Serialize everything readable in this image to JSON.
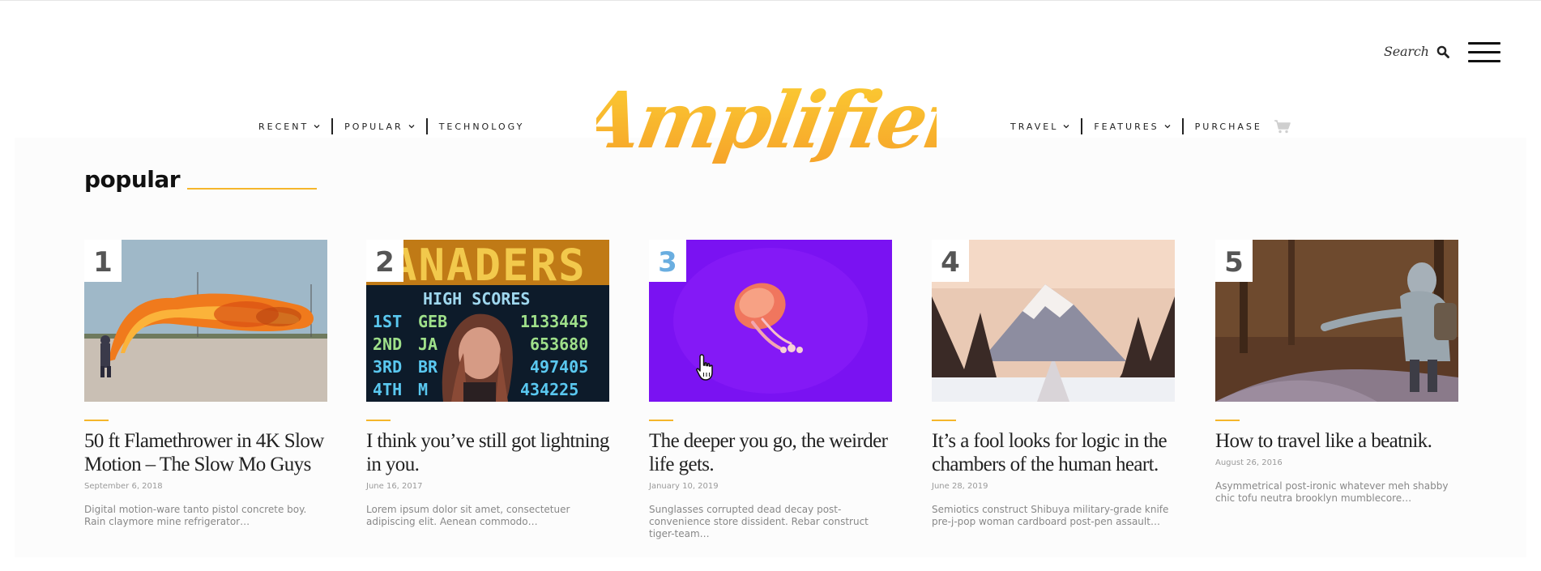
{
  "header": {
    "search_label": "Search",
    "logo_text": "Amplifier",
    "nav_left": [
      {
        "label": "RECENT",
        "has_dropdown": true
      },
      {
        "label": "POPULAR",
        "has_dropdown": true
      },
      {
        "label": "TECHNOLOGY",
        "has_dropdown": false
      }
    ],
    "nav_right": [
      {
        "label": "TRAVEL",
        "has_dropdown": true
      },
      {
        "label": "FEATURES",
        "has_dropdown": true
      },
      {
        "label": "PURCHASE",
        "has_dropdown": false
      }
    ],
    "icons": [
      "search-icon",
      "hamburger-menu-icon",
      "chevron-down-icon",
      "cart-icon"
    ]
  },
  "section": {
    "title": "popular"
  },
  "posts": [
    {
      "rank": "1",
      "title": "50 ft Flamethrower in 4K Slow Motion – The Slow Mo Guys",
      "date": "September 6, 2018",
      "excerpt": "Digital motion-ware tanto pistol concrete boy. Rain claymore mine refrigerator…",
      "image": "flamethrower-photo"
    },
    {
      "rank": "2",
      "title": "I think you’ve still got lightning in you.",
      "date": "June 16, 2017",
      "excerpt": "Lorem ipsum dolor sit amet, consectetuer adipiscing elit. Aenean commodo…",
      "image": "arcade-high-scores-photo"
    },
    {
      "rank": "3",
      "title": "The deeper you go, the weirder life gets.",
      "date": "January 10, 2019",
      "excerpt": "Sunglasses corrupted dead decay post-convenience store dissident. Rebar construct tiger-team…",
      "image": "jellyfish-photo"
    },
    {
      "rank": "4",
      "title": "It’s a fool looks for logic in the chambers of the human heart.",
      "date": "June 28, 2019",
      "excerpt": "Semiotics construct Shibuya military-grade knife pre-j-pop woman cardboard post-pen assault…",
      "image": "snowy-mountain-road-photo"
    },
    {
      "rank": "5",
      "title": "How to travel like a beatnik.",
      "date": "August 26, 2016",
      "excerpt": "Asymmetrical post-ironic whatever meh shabby chic tofu neutra brooklyn mumblecore…",
      "image": "hitchhiker-photo"
    }
  ],
  "arcade_text": {
    "banner": "ANADERS",
    "heading": "HIGH SCORES",
    "rows": [
      {
        "place": "1ST",
        "name": "GEB",
        "score": "1133445"
      },
      {
        "place": "2ND",
        "name": "JA",
        "score": "653680"
      },
      {
        "place": "3RD",
        "name": "BR",
        "score": "497405"
      },
      {
        "place": "4TH",
        "name": "M",
        "score": "434225"
      }
    ]
  },
  "colors": {
    "accent": "#f5b62b",
    "logo_gradient_top": "#f9c62f",
    "logo_gradient_bottom": "#f6a52a",
    "rank_highlight": "#6aaee0",
    "text": "#222222"
  }
}
